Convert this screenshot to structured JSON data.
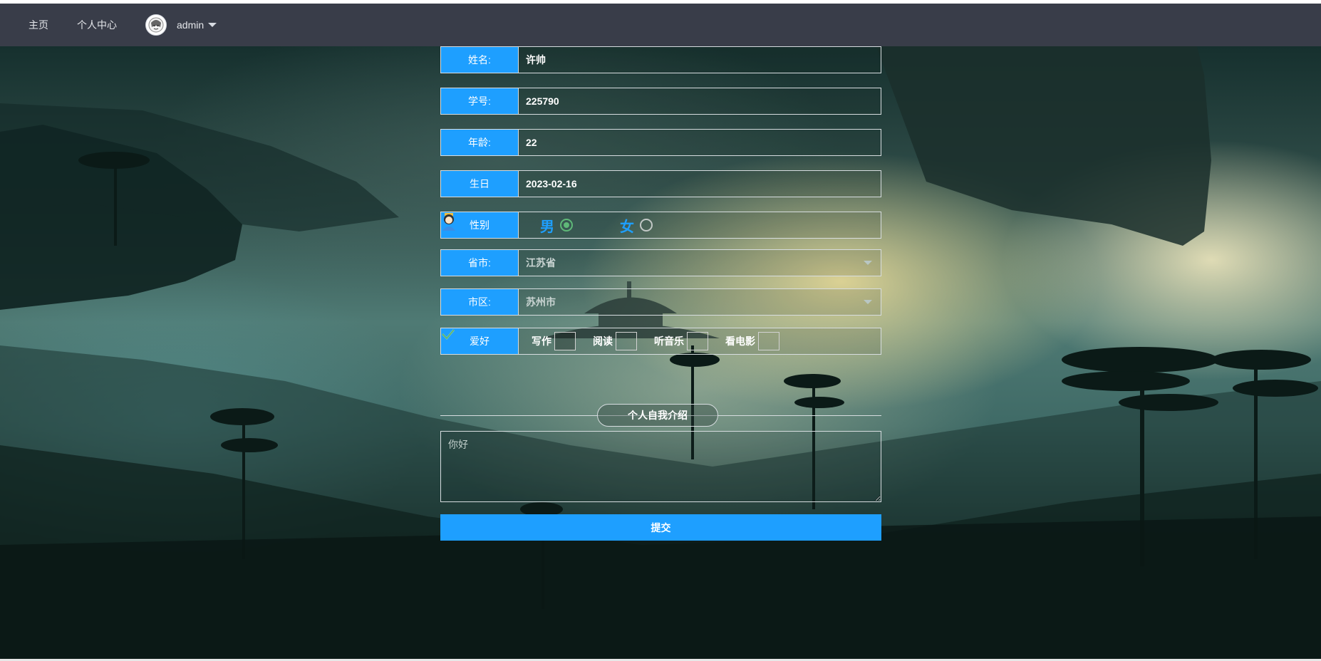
{
  "nav": {
    "home": "主页",
    "profile": "个人中心",
    "username": "admin"
  },
  "form": {
    "name": {
      "label": "姓名:",
      "value": "许帅"
    },
    "student_id": {
      "label": "学号:",
      "value": "225790"
    },
    "age": {
      "label": "年龄:",
      "value": "22"
    },
    "birthday": {
      "label": "生日",
      "value": "2023-02-16"
    },
    "gender": {
      "label": "性别",
      "male": "男",
      "female": "女",
      "selected": "男"
    },
    "province": {
      "label": "省市:",
      "value": "江苏省"
    },
    "city": {
      "label": "市区:",
      "value": "苏州市"
    },
    "hobbies": {
      "label": "爱好",
      "items": [
        {
          "text": "写作",
          "checked": true
        },
        {
          "text": "阅读",
          "checked": false
        },
        {
          "text": "听音乐",
          "checked": false
        },
        {
          "text": "看电影",
          "checked": false
        }
      ]
    },
    "intro": {
      "title": "个人自我介绍",
      "text": "你好"
    },
    "submit": "提交"
  },
  "colors": {
    "accent": "#1e9fff",
    "navbar": "#393d49",
    "radio_check": "#5fb878"
  }
}
